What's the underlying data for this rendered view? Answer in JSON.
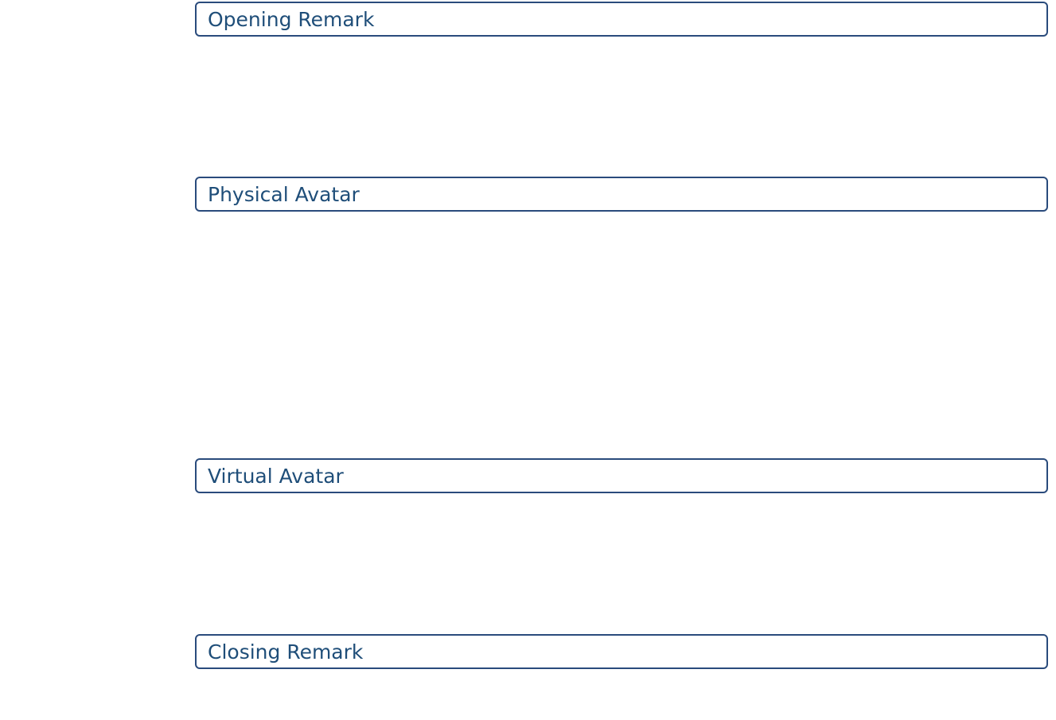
{
  "sections": [
    {
      "label": "Opening Remark"
    },
    {
      "label": "Physical Avatar"
    },
    {
      "label": "Virtual Avatar"
    },
    {
      "label": "Closing Remark"
    }
  ],
  "colors": {
    "border": "#2a4b7c",
    "text": "#1f4e79",
    "background": "#ffffff"
  }
}
